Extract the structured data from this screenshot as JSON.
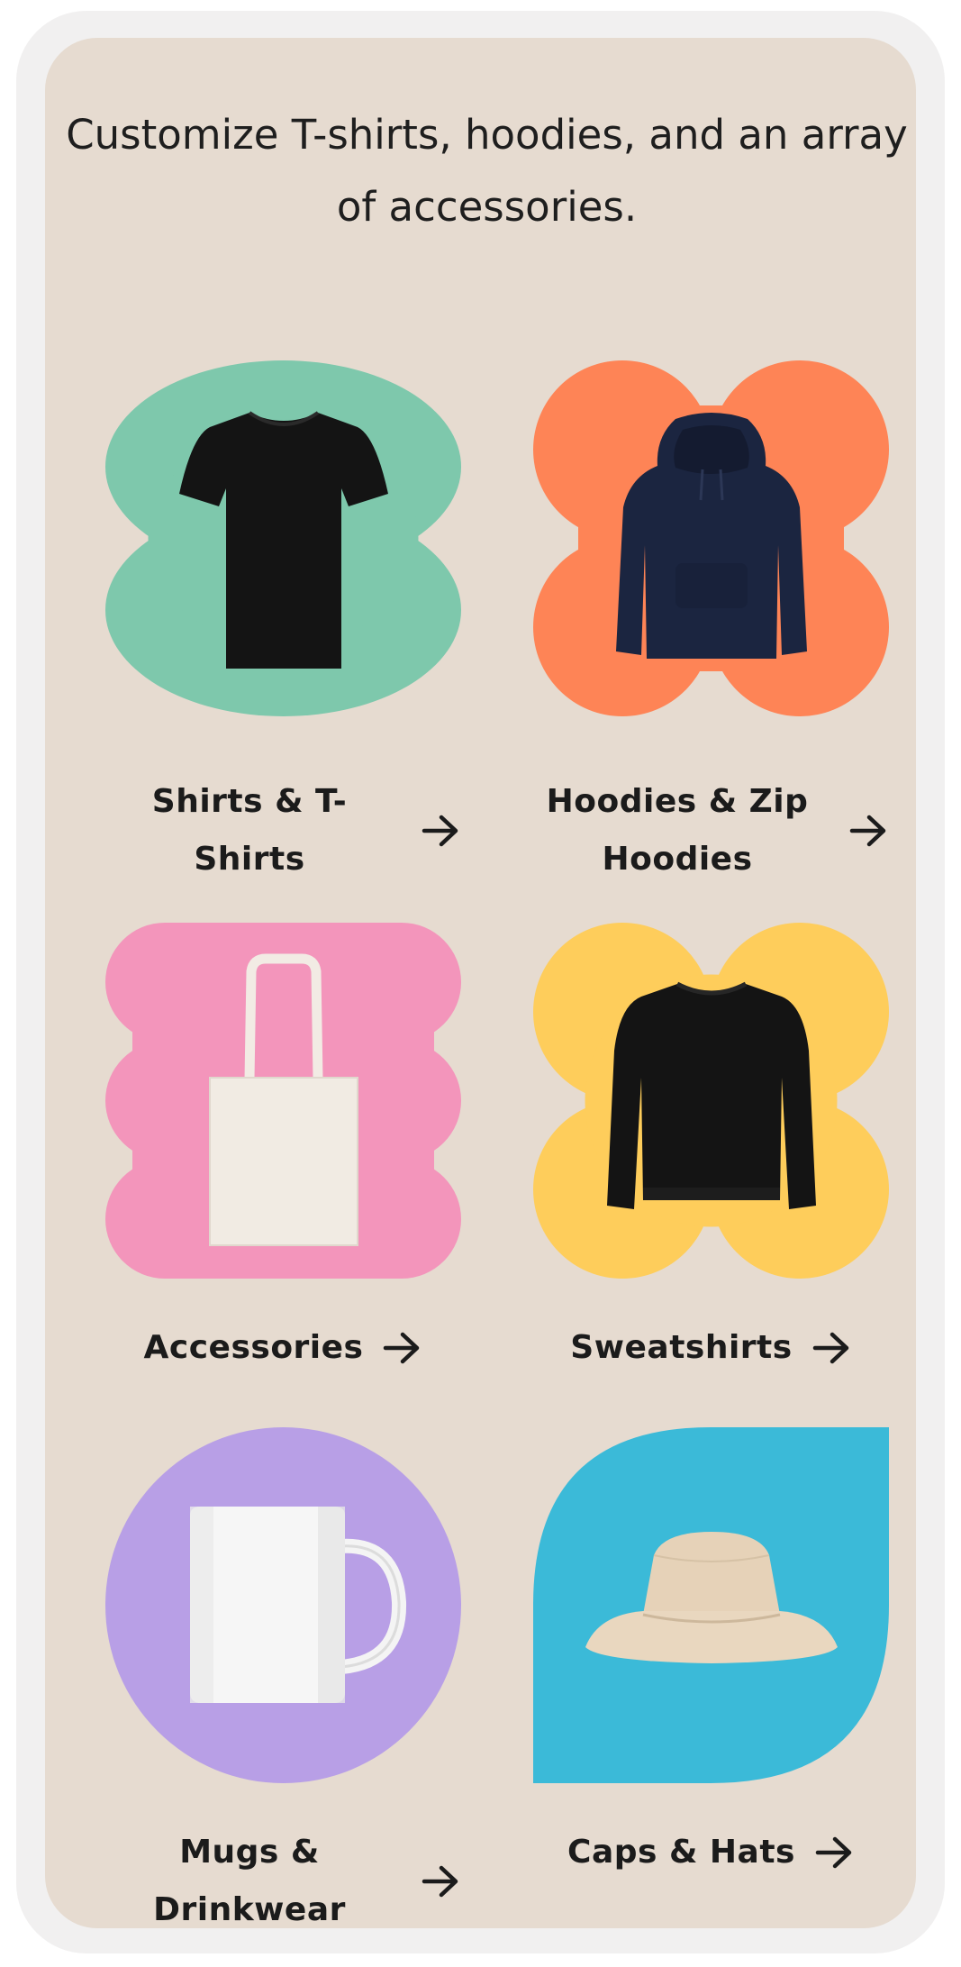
{
  "intro_text": "Customize T-shirts, hoodies, and an array of accessories.",
  "categories": [
    {
      "label": "Shirts & T-Shirts",
      "line1": "Shirts & T-",
      "line2": "Shirts",
      "shape_color": "#7ec8ac",
      "product_icon": "tshirt-icon"
    },
    {
      "label": "Hoodies & Zip Hoodies",
      "line1": "Hoodies & Zip",
      "line2": "Hoodies",
      "shape_color": "#fe8456",
      "product_icon": "hoodie-icon"
    },
    {
      "label": "Accessories",
      "shape_color": "#f395bb",
      "product_icon": "tote-bag-icon"
    },
    {
      "label": "Sweatshirts",
      "shape_color": "#fecd5b",
      "product_icon": "sweatshirt-icon"
    },
    {
      "label": "Mugs & Drinkwear",
      "line1": "Mugs &",
      "line2": "Drinkwear",
      "shape_color": "#b89fe6",
      "product_icon": "mug-icon"
    },
    {
      "label": "Caps & Hats",
      "shape_color": "#3bbad8",
      "product_icon": "bucket-hat-icon"
    }
  ],
  "colors": {
    "frame": "#f1f0f0",
    "screen_background": "#e6dbd0",
    "text": "#1b1b1b"
  }
}
